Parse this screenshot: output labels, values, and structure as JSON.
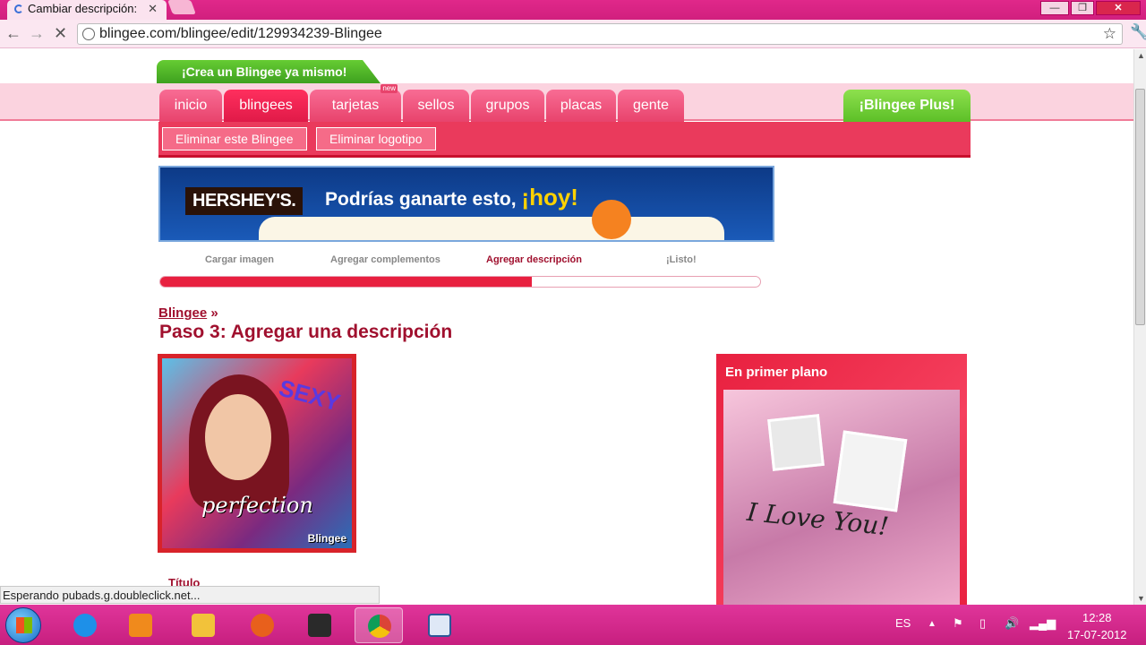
{
  "browser": {
    "tab_title": "Cambiar descripción:",
    "url": "blingee.com/blingee/edit/129934239-Blingee",
    "status_text": "Esperando pubads.g.doubleclick.net..."
  },
  "site": {
    "crea_label": "¡Crea un Blingee ya mismo!",
    "nav_tabs": [
      {
        "label": "inicio"
      },
      {
        "label": "blingees"
      },
      {
        "label": "tarjetas",
        "badge": "new"
      },
      {
        "label": "sellos"
      },
      {
        "label": "grupos"
      },
      {
        "label": "placas"
      },
      {
        "label": "gente"
      }
    ],
    "plus_label": "¡Blingee Plus!",
    "sub_buttons": [
      "Eliminar este Blingee",
      "Eliminar logotipo"
    ]
  },
  "banner": {
    "brand": "HERSHEY'S.",
    "text": "Podrías ganarte esto,",
    "highlight": "¡hoy!"
  },
  "steps": {
    "items": [
      "Cargar imagen",
      "Agregar complementos",
      "Agregar descripción",
      "¡Listo!"
    ],
    "current_index": 2,
    "progress_percent": 62
  },
  "main": {
    "breadcrumb": "Blingee",
    "breadcrumb_sep": "»",
    "title": "Paso 3: Agregar una descripción",
    "image_texts": {
      "sexy": "SEXY",
      "perfection": "perfection",
      "watermark": "Blingee"
    },
    "field_label": "Título"
  },
  "sidebar": {
    "heading": "En primer plano",
    "image_text": "I Love You!"
  },
  "taskbar": {
    "language": "ES",
    "time": "12:28",
    "date": "17-07-2012"
  },
  "colors": {
    "accent": "#e8203f",
    "brand_pink": "#e0288a",
    "green": "#5cbf27"
  }
}
